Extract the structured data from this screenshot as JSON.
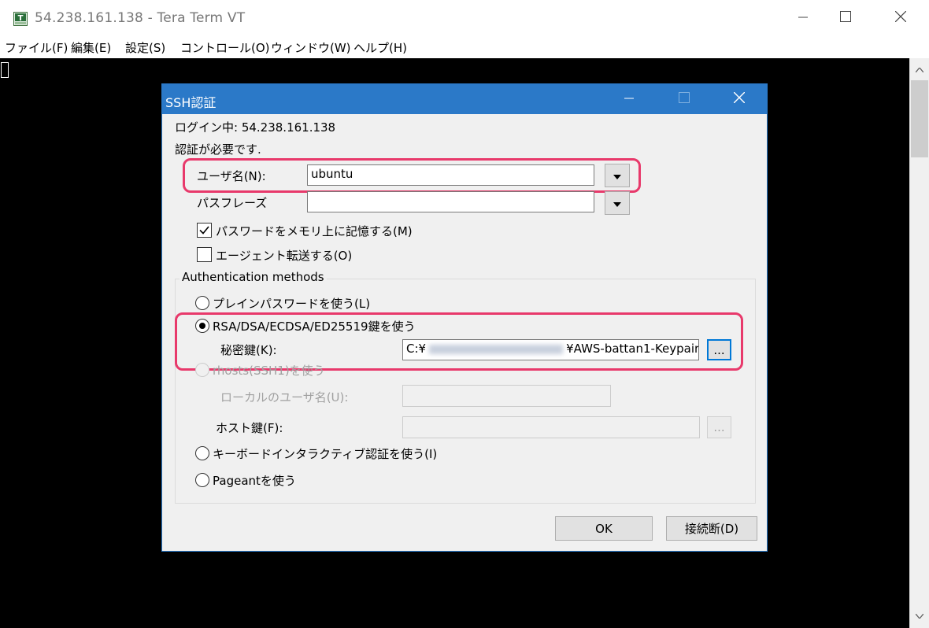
{
  "window": {
    "title": "54.238.161.138 - Tera Term VT",
    "icon": "teraterm-icon",
    "controls": {
      "minimize": "minimize-icon",
      "maximize": "maximize-icon",
      "close": "close-icon"
    }
  },
  "menubar": {
    "items": [
      "ファイル(F)",
      "編集(E)",
      "設定(S)",
      "コントロール(O)",
      "ウィンドウ(W)",
      "ヘルプ(H)"
    ]
  },
  "dialog": {
    "title": "SSH認証",
    "login_line": "ログイン中: 54.238.161.138",
    "auth_required": "認証が必要です.",
    "username_label": "ユーザ名(N):",
    "username_value": "ubuntu",
    "passphrase_label": "パスフレーズ",
    "passphrase_value": "",
    "remember_password_label": "パスワードをメモリ上に記憶する(M)",
    "remember_password_checked": true,
    "agent_forward_label": "エージェント転送する(O)",
    "agent_forward_checked": false,
    "auth_methods_label": "Authentication methods",
    "methods": {
      "plain": "プレインパスワードを使う(L)",
      "rsa": "RSA/DSA/ECDSA/ED25519鍵を使う",
      "rhosts": "rhosts(SSH1)を使う",
      "keyboard": "キーボードインタラクティブ認証を使う(I)",
      "pageant": "Pageantを使う"
    },
    "selected_method": "rsa",
    "private_key_label": "秘密鍵(K):",
    "private_key_prefix": "C:¥",
    "private_key_suffix": "¥AWS-battan1-Keypair",
    "browse_label": "...",
    "local_user_label": "ローカルのユーザ名(U):",
    "host_key_label": "ホスト鍵(F):",
    "ok_label": "OK",
    "disconnect_label": "接続断(D)"
  },
  "colors": {
    "accent": "#2b79c8",
    "highlight": "#e8396b",
    "terminal_bg": "#000000"
  }
}
